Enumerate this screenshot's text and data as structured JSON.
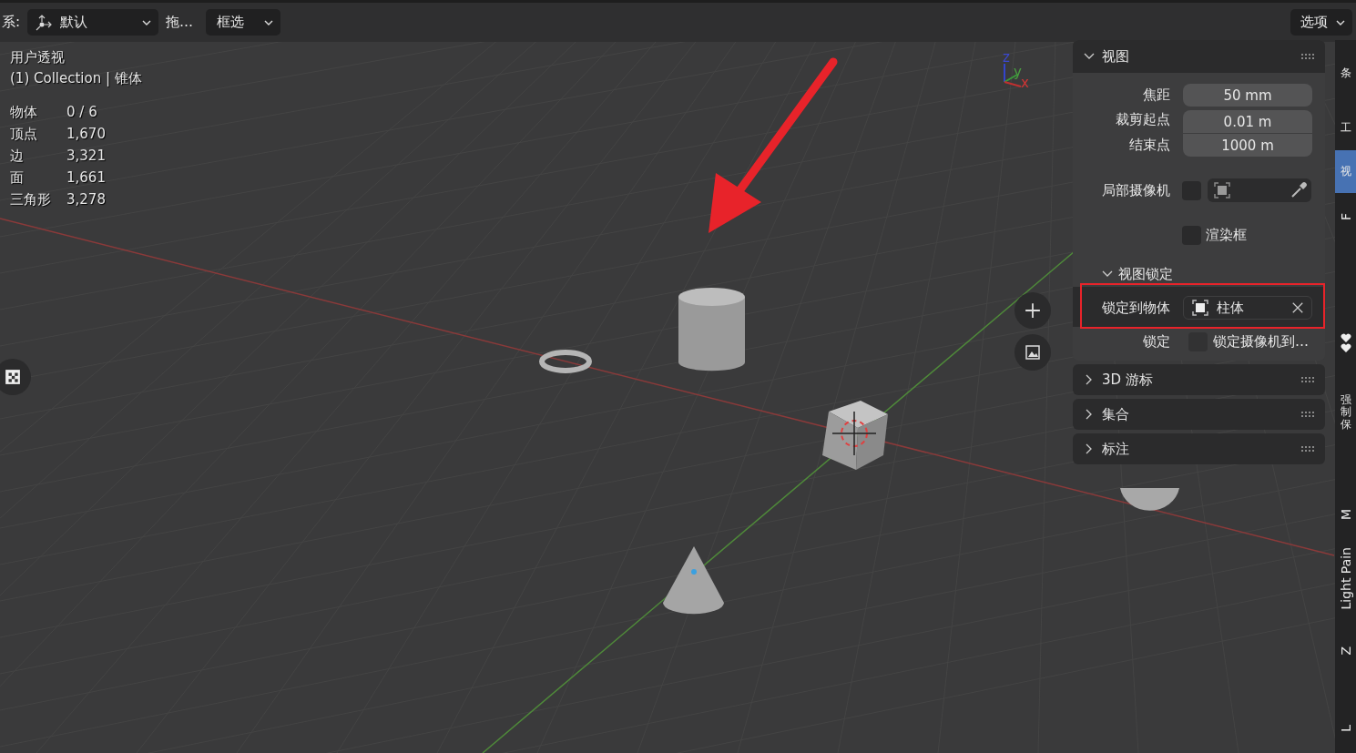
{
  "header": {
    "coord_label": "系:",
    "orientation_dropdown": {
      "value": "默认"
    },
    "drag_label": "拖…",
    "select_dropdown": {
      "value": "框选"
    },
    "options_button": {
      "label": "选项"
    }
  },
  "viewport_info": {
    "view_name": "用户透视",
    "collection": "(1) Collection | 锥体",
    "stats": [
      {
        "label": "物体",
        "value": "0 / 6"
      },
      {
        "label": "顶点",
        "value": "1,670"
      },
      {
        "label": "边",
        "value": "3,321"
      },
      {
        "label": "面",
        "value": "1,661"
      },
      {
        "label": "三角形",
        "value": "3,278"
      }
    ]
  },
  "axis_gizmo": {
    "axes": [
      "z",
      "y",
      "x"
    ]
  },
  "side_panel": {
    "view_section": {
      "title": "视图",
      "expanded": true,
      "fields": [
        {
          "label": "焦距",
          "value": "50 mm"
        },
        {
          "label": "裁剪起点",
          "value": "0.01 m"
        },
        {
          "label": "结束点",
          "value": "1000 m"
        }
      ],
      "local_camera": {
        "label": "局部摄像机",
        "checked": false
      },
      "render_border": {
        "label": "渲染框",
        "checked": false
      },
      "lock_section": {
        "title": "视图锁定",
        "expanded": true,
        "lock_object": {
          "label": "锁定到物体",
          "value": "柱体"
        },
        "lock": {
          "label": "锁定",
          "checked": false,
          "option": "锁定摄像机到…"
        }
      }
    },
    "sections": [
      {
        "title": "3D 游标",
        "expanded": false
      },
      {
        "title": "集合",
        "expanded": false
      },
      {
        "title": "标注",
        "expanded": false
      }
    ]
  },
  "side_tabs": [
    {
      "kind": "text",
      "label": "条",
      "selected": false
    },
    {
      "kind": "text",
      "label": "工",
      "selected": false
    },
    {
      "kind": "text",
      "label": "视",
      "selected": true
    },
    {
      "kind": "latin",
      "label": "F",
      "selected": false
    },
    {
      "kind": "icon",
      "selected": false
    },
    {
      "kind": "text",
      "label": "强制保",
      "selected": false
    },
    {
      "kind": "latin",
      "label": "M",
      "selected": false
    },
    {
      "kind": "latin",
      "label": "Light Pain",
      "selected": false
    },
    {
      "kind": "latin",
      "label": "Z",
      "selected": false
    },
    {
      "kind": "latin",
      "label": "L",
      "selected": false
    }
  ]
}
